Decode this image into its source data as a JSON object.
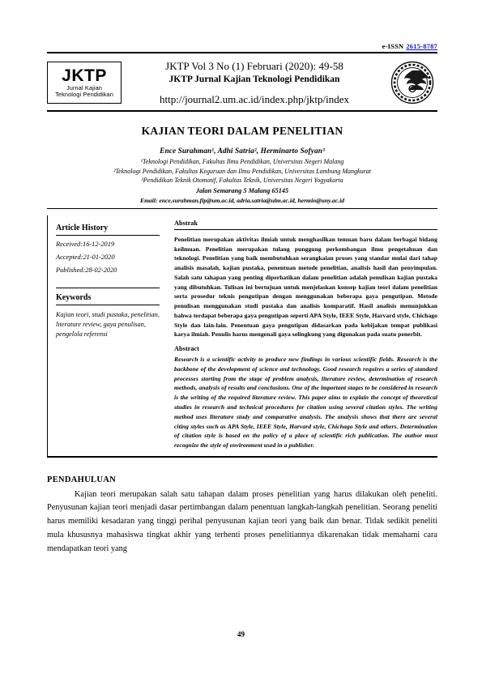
{
  "header": {
    "issn_label": "e-ISSN",
    "issn_value": "2615-8787",
    "logo": {
      "acronym": "JKTP",
      "sub_line1": "Jurnal Kajian",
      "sub_line2": "Teknologi Pendidikan"
    },
    "volume_line": "JKTP Vol 3 No (1) Februari (2020): 49-58",
    "journal_name": "JKTP Jurnal Kajian Teknologi Pendidikan",
    "url": "http://journal2.um.ac.id/index.php/jktp/index",
    "seal_name": "universitas-negeri-malang-seal"
  },
  "article": {
    "title": "KAJIAN TEORI DALAM PENELITIAN",
    "authors": "Ence Surahman¹, Adhi Satria², Herminarto Sofyan³",
    "affiliations": [
      "¹Teknologi Pendidikan, Fakultas Ilmu Pendidikan, Universitas Negeri Malang",
      "²Teknologi Pendidikan, Fakultas Keguruan dan Ilmu Pendidikan, Universitas Lambung Mangkurat",
      "³Pendidikan Teknik Otomotif, Fakultas Teknik, Universitas Negeri Yogyakarta"
    ],
    "address": "Jalan Semarang 5 Malang 65145",
    "emails": "Email: ence.surahman.fip@um.ac.id, adria.satria@ulm.ac.id, hermin@uny.ac.id"
  },
  "sidebar": {
    "history_heading": "Article History",
    "history_items": [
      "Received:16-12-2019",
      "Accepted:21-01-2020",
      "Published:28-02-2020"
    ],
    "keywords_heading": "Keywords",
    "keywords_text": "Kajian teori, studi pustaka, penelitian, literature review, gaya penulisan, pengelola referensi"
  },
  "abstract": {
    "id_heading": "Abstrak",
    "id_text": "Penelitian merupakan aktivitas ilmiah untuk menghasilkan temuan baru dalam berbagai bidang keilmuan. Penelitian merupakan tulang punggung perkembangan ilmu pengetahuan dan teknologi. Penelitian yang baik membutuhkan serangkaian proses yang standar mulai dari tahap analisis masalah, kajian pustaka, penentuan metode penelitian, analisis hasil dan penyimpulan. Salah satu tahapan yang penting diperhatikan dalam penelitian adalah penulisan kajian pustaka yang dibutuhkan. Tulisan ini bertujuan untuk menjelaskan konsep kajian teori dalam penelitian serta prosedur teknis pengutipan dengan menggunakan beberapa gaya pengutipan. Metode penulisan menggunakan studi pustaka dan analisis komparatif. Hasil analisis menunjukkan bahwa terdapat beberapa gaya pengutipan seperti APA Style, IEEE Style, Harvard style, Chichago Style dan lain-lain. Penentuan gaya pengutipan didasarkan pada kebijakan tempat publikasi karya ilmiah. Penulis harus mengenali gaya selingkung yang digunakan pada suatu penerbit.",
    "en_heading": "Abstract",
    "en_text": "Research is a scientific activity to produce new findings in various scientific fields. Research is the backbone of the development of science and technology. Good research requires a series of standard processes starting from the stage of problem analysis, literature review, determination of research methods, analysis of results and conclusions. One of the important stages to be considered in research is the writing of the required literature review. This paper aims to explain the concept of theoretical studies in research and technical procedures for citation using several citation styles. The writing method uses literature study and comparative analysis. The analysis shows that there are several citing styles such as APA Style, IEEE Style, Harvard style, Chichago Style and others. Determination of citation style is based on the policy of a place of scientific rich publication. The author must recognize the style of environment used in a publisher."
  },
  "introduction": {
    "heading": "PENDAHULUAN",
    "paragraph": "Kajian teori merupakan salah satu tahapan dalam proses penelitian yang harus dilakukan oleh peneliti. Penyusunan kajian teori menjadi dasar pertimbangan dalam penentuan langkah-langkah penelitian. Seorang peneliti harus memiliki kesadaran yang tinggi perihal penyusunan kajian teori yang baik dan benar. Tidak sedikit peneliti mula khususnya mahasiswa tingkat akhir yang terhenti proses penelitiannya dikarenakan tidak memahami cara mendapatkan teori yang"
  },
  "footer": {
    "page_number": "49"
  },
  "colors": {
    "link": "#1010c8",
    "text": "#000000",
    "page_background": "#ffffff"
  }
}
